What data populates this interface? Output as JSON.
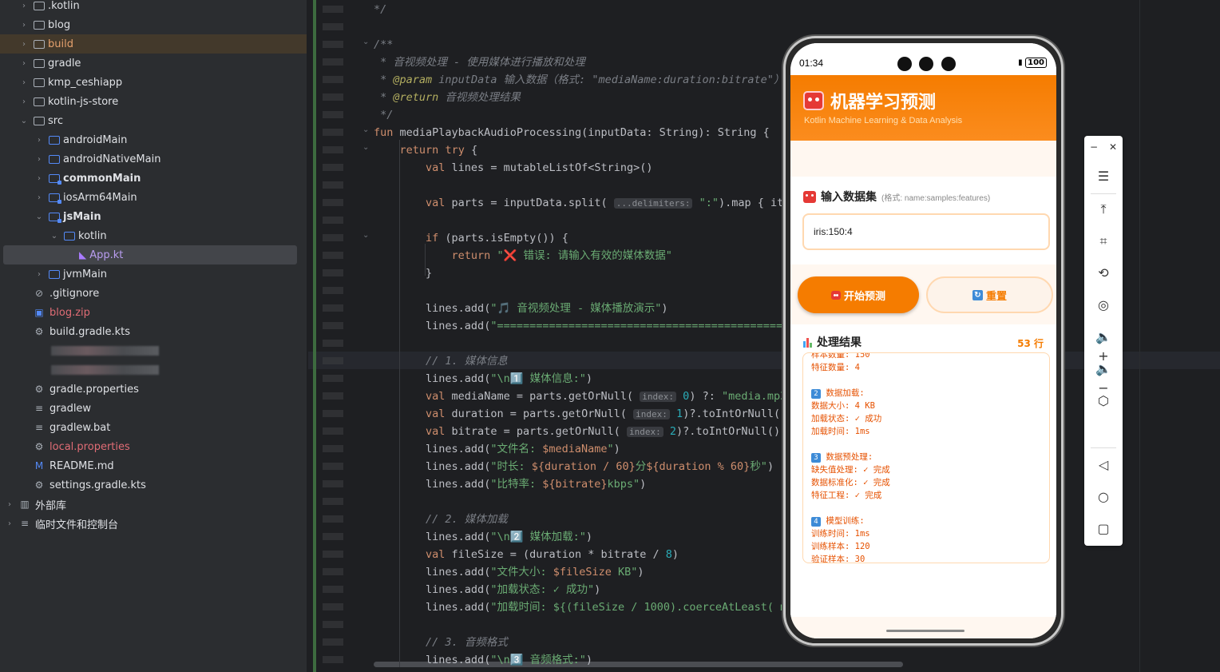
{
  "tree": {
    "items": [
      {
        "label": ".kotlin",
        "depth": 0,
        "type": "folder",
        "chev": ">"
      },
      {
        "label": "blog",
        "depth": 0,
        "type": "folder",
        "chev": ">"
      },
      {
        "label": "build",
        "depth": 0,
        "type": "folder",
        "chev": ">"
      },
      {
        "label": "gradle",
        "depth": 0,
        "type": "folder",
        "chev": ">"
      },
      {
        "label": "kmp_ceshiapp",
        "depth": 0,
        "type": "folder",
        "chev": ">"
      },
      {
        "label": "kotlin-js-store",
        "depth": 0,
        "type": "folder",
        "chev": ">"
      },
      {
        "label": "src",
        "depth": 0,
        "type": "folder",
        "chev": "v"
      },
      {
        "label": "androidMain",
        "depth": 1,
        "type": "folder",
        "chev": ">"
      },
      {
        "label": "androidNativeMain",
        "depth": 1,
        "type": "folder",
        "chev": ">"
      },
      {
        "label": "commonMain",
        "depth": 1,
        "type": "folder",
        "chev": ">"
      },
      {
        "label": "iosArm64Main",
        "depth": 1,
        "type": "folder",
        "chev": ">"
      },
      {
        "label": "jsMain",
        "depth": 1,
        "type": "folder",
        "chev": "v"
      },
      {
        "label": "kotlin",
        "depth": 2,
        "type": "folder",
        "chev": "v"
      },
      {
        "label": "App.kt",
        "depth": 3,
        "type": "kt",
        "chev": ""
      },
      {
        "label": "jvmMain",
        "depth": 1,
        "type": "folder",
        "chev": ">"
      },
      {
        "label": ".gitignore",
        "depth": 0,
        "type": "file",
        "chev": ""
      },
      {
        "label": "blog.zip",
        "depth": 0,
        "type": "file",
        "chev": ""
      },
      {
        "label": "build.gradle.kts",
        "depth": 0,
        "type": "file",
        "chev": ""
      },
      {
        "label": "",
        "depth": 0,
        "type": "blur",
        "chev": ""
      },
      {
        "label": "",
        "depth": 0,
        "type": "blur",
        "chev": ""
      },
      {
        "label": "gradle.properties",
        "depth": 0,
        "type": "file",
        "chev": ""
      },
      {
        "label": "gradlew",
        "depth": 0,
        "type": "file",
        "chev": ""
      },
      {
        "label": "gradlew.bat",
        "depth": 0,
        "type": "file",
        "chev": ""
      },
      {
        "label": "local.properties",
        "depth": 0,
        "type": "file",
        "chev": ""
      },
      {
        "label": "README.md",
        "depth": 0,
        "type": "file",
        "chev": ""
      },
      {
        "label": "settings.gradle.kts",
        "depth": 0,
        "type": "file",
        "chev": ""
      },
      {
        "label": "外部库",
        "depth": -1,
        "type": "lib",
        "chev": ">"
      },
      {
        "label": "临时文件和控制台",
        "depth": -1,
        "type": "scratch",
        "chev": ">"
      }
    ]
  },
  "editor": {
    "lines": [
      "*/",
      "",
      "/**",
      " * 音视频处理 - 使用媒体进行播放和处理",
      " * @param inputData 输入数据（格式: \"mediaName:duration:bitrate\"）",
      " * @return 音视频处理结果",
      " */",
      "fun mediaPlaybackAudioProcessing(inputData: String): String {  新",
      "    return try {",
      "        val lines = mutableListOf<String>()",
      "",
      "        val parts = inputData.split( ...delimiters: \":\").map { it.trim",
      "",
      "        if (parts.isEmpty()) {",
      "            return \"❌ 错误: 请输入有效的媒体数据\"",
      "        }",
      "",
      "        lines.add(\"🎵 音视频处理 - 媒体播放演示\")",
      "        lines.add(\"================================================",
      "",
      "        // 1. 媒体信息",
      "        lines.add(\"\\n1️⃣ 媒体信息:\")",
      "        val mediaName = parts.getOrNull( index: 0) ?: \"media.mp3\"",
      "        val duration = parts.getOrNull( index: 1)?.toIntOrNull() ?",
      "        val bitrate = parts.getOrNull( index: 2)?.toIntOrNull() ?:",
      "        lines.add(\"文件名: $mediaName\")",
      "        lines.add(\"时长: ${duration / 60}分${duration % 60}秒\")",
      "        lines.add(\"比特率: ${bitrate}kbps\")",
      "",
      "        // 2. 媒体加载",
      "        lines.add(\"\\n2️⃣ 媒体加载:\")",
      "        val fileSize = (duration * bitrate / 8)",
      "        lines.add(\"文件大小: $fileSize KB\")",
      "        lines.add(\"加载状态: ✓ 成功\")",
      "        lines.add(\"加载时间: ${(fileSize / 1000).coerceAtLeast( mi",
      "",
      "        // 3. 音频格式",
      "        lines.add(\"\\n3️⃣ 音频格式:\")"
    ]
  },
  "phone": {
    "time": "01:34",
    "battery": "100",
    "app_title": "机器学习预测",
    "app_subtitle": "Kotlin Machine Learning & Data Analysis",
    "input_section_title": "输入数据集",
    "input_format": "(格式: name:samples:features)",
    "input_value": "iris:150:4",
    "start_button": "开始预测",
    "reset_button": "重置",
    "result_title": "处理结果",
    "result_count": "53 行",
    "result_lines": [
      "样本数量: 150",
      "特征数量: 4",
      "",
      "2 数据加载:",
      "数据大小: 4 KB",
      "加载状态: ✓ 成功",
      "加载时间: 1ms",
      "",
      "3 数据预处理:",
      "缺失值处理: ✓ 完成",
      "数据标准化: ✓ 完成",
      "特征工程: ✓ 完成",
      "",
      "4 模型训练:",
      "训练时间: 1ms",
      "训练样本: 120",
      "验证样本: 30"
    ]
  },
  "emulator_toolbar": {
    "minimize": "−",
    "close": "✕",
    "icons": [
      "menu-icon",
      "pin-top-icon",
      "crop-icon",
      "rotate-icon",
      "screenshot-icon",
      "volume-up-icon",
      "volume-down-icon",
      "fold-icon",
      "back-icon",
      "home-icon",
      "overview-icon"
    ]
  },
  "colors": {
    "accent": "#f57c00",
    "ide_bg": "#1e1f22",
    "panel_bg": "#2b2d30"
  }
}
